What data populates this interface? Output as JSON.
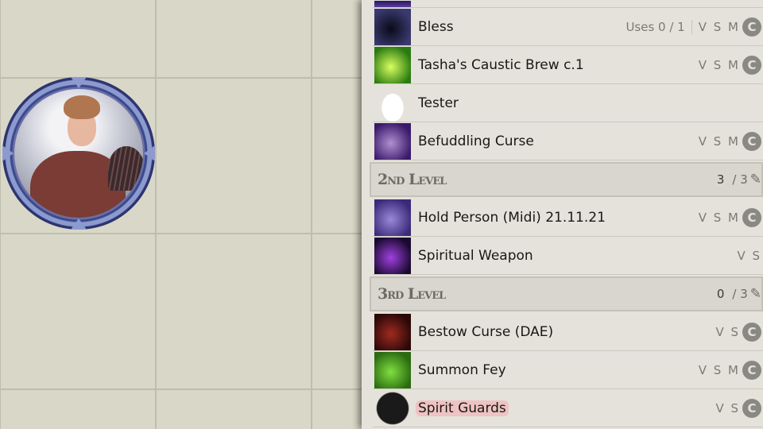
{
  "rows": [
    {
      "type": "partial",
      "icon": "purple-glyph-icon",
      "colors": [
        "#2a1a5a",
        "#5a3aa0"
      ]
    },
    {
      "type": "spell",
      "name": "Bless",
      "icon": "bless-icon",
      "colors": [
        "#0a0a18",
        "#3a3a70"
      ],
      "uses": "Uses 0 / 1",
      "components": "V S M",
      "concentration": "C"
    },
    {
      "type": "spell",
      "name": "Tasha's Caustic Brew c.1",
      "icon": "caustic-brew-icon",
      "colors": [
        "#d8ff60",
        "#2a7a10"
      ],
      "components": "V S M",
      "concentration": "C"
    },
    {
      "type": "spell",
      "name": "Tester",
      "icon": "sack-icon",
      "colors": [
        "#ffffff",
        "#ffffff"
      ]
    },
    {
      "type": "spell",
      "name": "Befuddling Curse",
      "icon": "eye-icon",
      "colors": [
        "#b090d0",
        "#3a1a6a"
      ],
      "components": "V S M",
      "concentration": "C"
    },
    {
      "type": "header",
      "label": "2nd Level",
      "value": "3",
      "max": "/ 3"
    },
    {
      "type": "spell",
      "name": "Hold Person (Midi) 21.11.21",
      "icon": "hold-person-icon",
      "colors": [
        "#9a88d8",
        "#3a2a7a"
      ],
      "components": "V S M",
      "concentration": "C"
    },
    {
      "type": "spell",
      "name": "Spiritual Weapon",
      "icon": "spiritual-weapon-icon",
      "colors": [
        "#a040e0",
        "#1a0a30"
      ],
      "components": "V S"
    },
    {
      "type": "header",
      "label": "3rd Level",
      "value": "0",
      "max": "/ 3"
    },
    {
      "type": "spell",
      "name": "Bestow Curse (DAE)",
      "icon": "bestow-curse-icon",
      "colors": [
        "#a02a20",
        "#2a0808"
      ],
      "components": "V S",
      "concentration": "C"
    },
    {
      "type": "spell",
      "name": "Summon Fey",
      "icon": "summon-fey-icon",
      "colors": [
        "#80e040",
        "#2a6a10"
      ],
      "components": "V S M",
      "concentration": "C",
      "highlight": "faint"
    },
    {
      "type": "spell",
      "name": "Spirit Guards",
      "icon": "d20-icon",
      "colors": [
        "#1a1a1a",
        "#ffffff"
      ],
      "components": "V S",
      "concentration": "C",
      "highlight": "strong"
    }
  ],
  "edit_icon": "✎"
}
